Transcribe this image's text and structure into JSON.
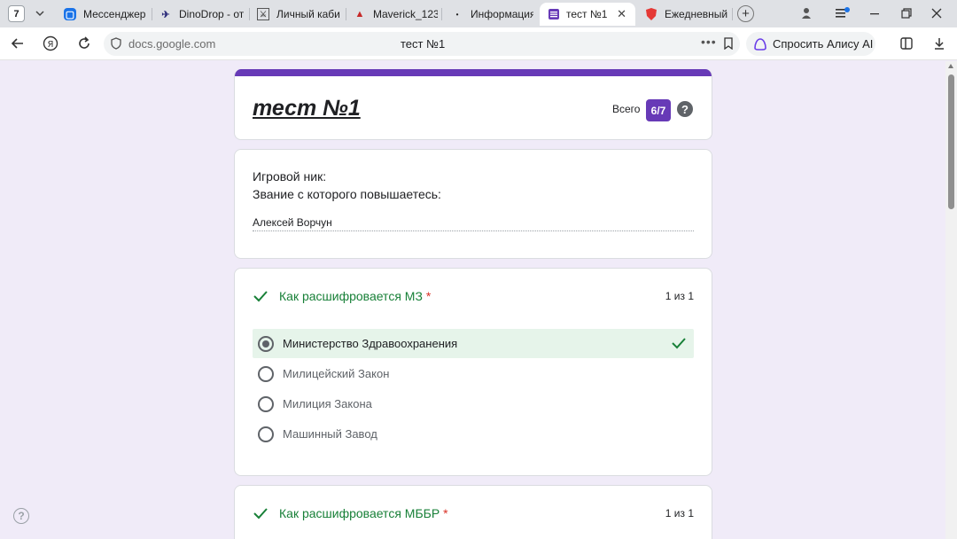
{
  "browser": {
    "tab_count": "7",
    "tabs": [
      {
        "label": "Мессенджер"
      },
      {
        "label": "DinoDrop - от"
      },
      {
        "label": "Личный каби"
      },
      {
        "label": "Maverick_123"
      },
      {
        "label": "Информация"
      },
      {
        "label": "тест №1"
      },
      {
        "label": "Ежедневный"
      }
    ],
    "address": "docs.google.com",
    "page_title": "тест №1",
    "alice_label": "Спросить Алису AI"
  },
  "form": {
    "title": "тест №1",
    "score_label": "Всего",
    "score": "6/7",
    "help_symbol": "?",
    "info": {
      "line1": "Игровой ник:",
      "line2": "Звание с которого повышаетесь:",
      "answer": "Алексей Ворчун"
    },
    "questions": [
      {
        "title": "Как расшифровается МЗ",
        "required": "*",
        "points": "1 из 1",
        "options": [
          {
            "label": "Министерство Здравоохранения",
            "selected": true,
            "correct": true
          },
          {
            "label": "Милицейский Закон",
            "selected": false,
            "correct": false
          },
          {
            "label": "Милиция Закона",
            "selected": false,
            "correct": false
          },
          {
            "label": "Машинный Завод",
            "selected": false,
            "correct": false
          }
        ]
      },
      {
        "title": "Как расшифровается МББР",
        "required": "*",
        "points": "1 из 1"
      }
    ]
  },
  "page_help": "?",
  "colors": {
    "accent": "#673ab7",
    "correct_green": "#188038",
    "correct_bg": "#e6f4ea",
    "required_red": "#d93025",
    "background": "#f0ebf8"
  }
}
